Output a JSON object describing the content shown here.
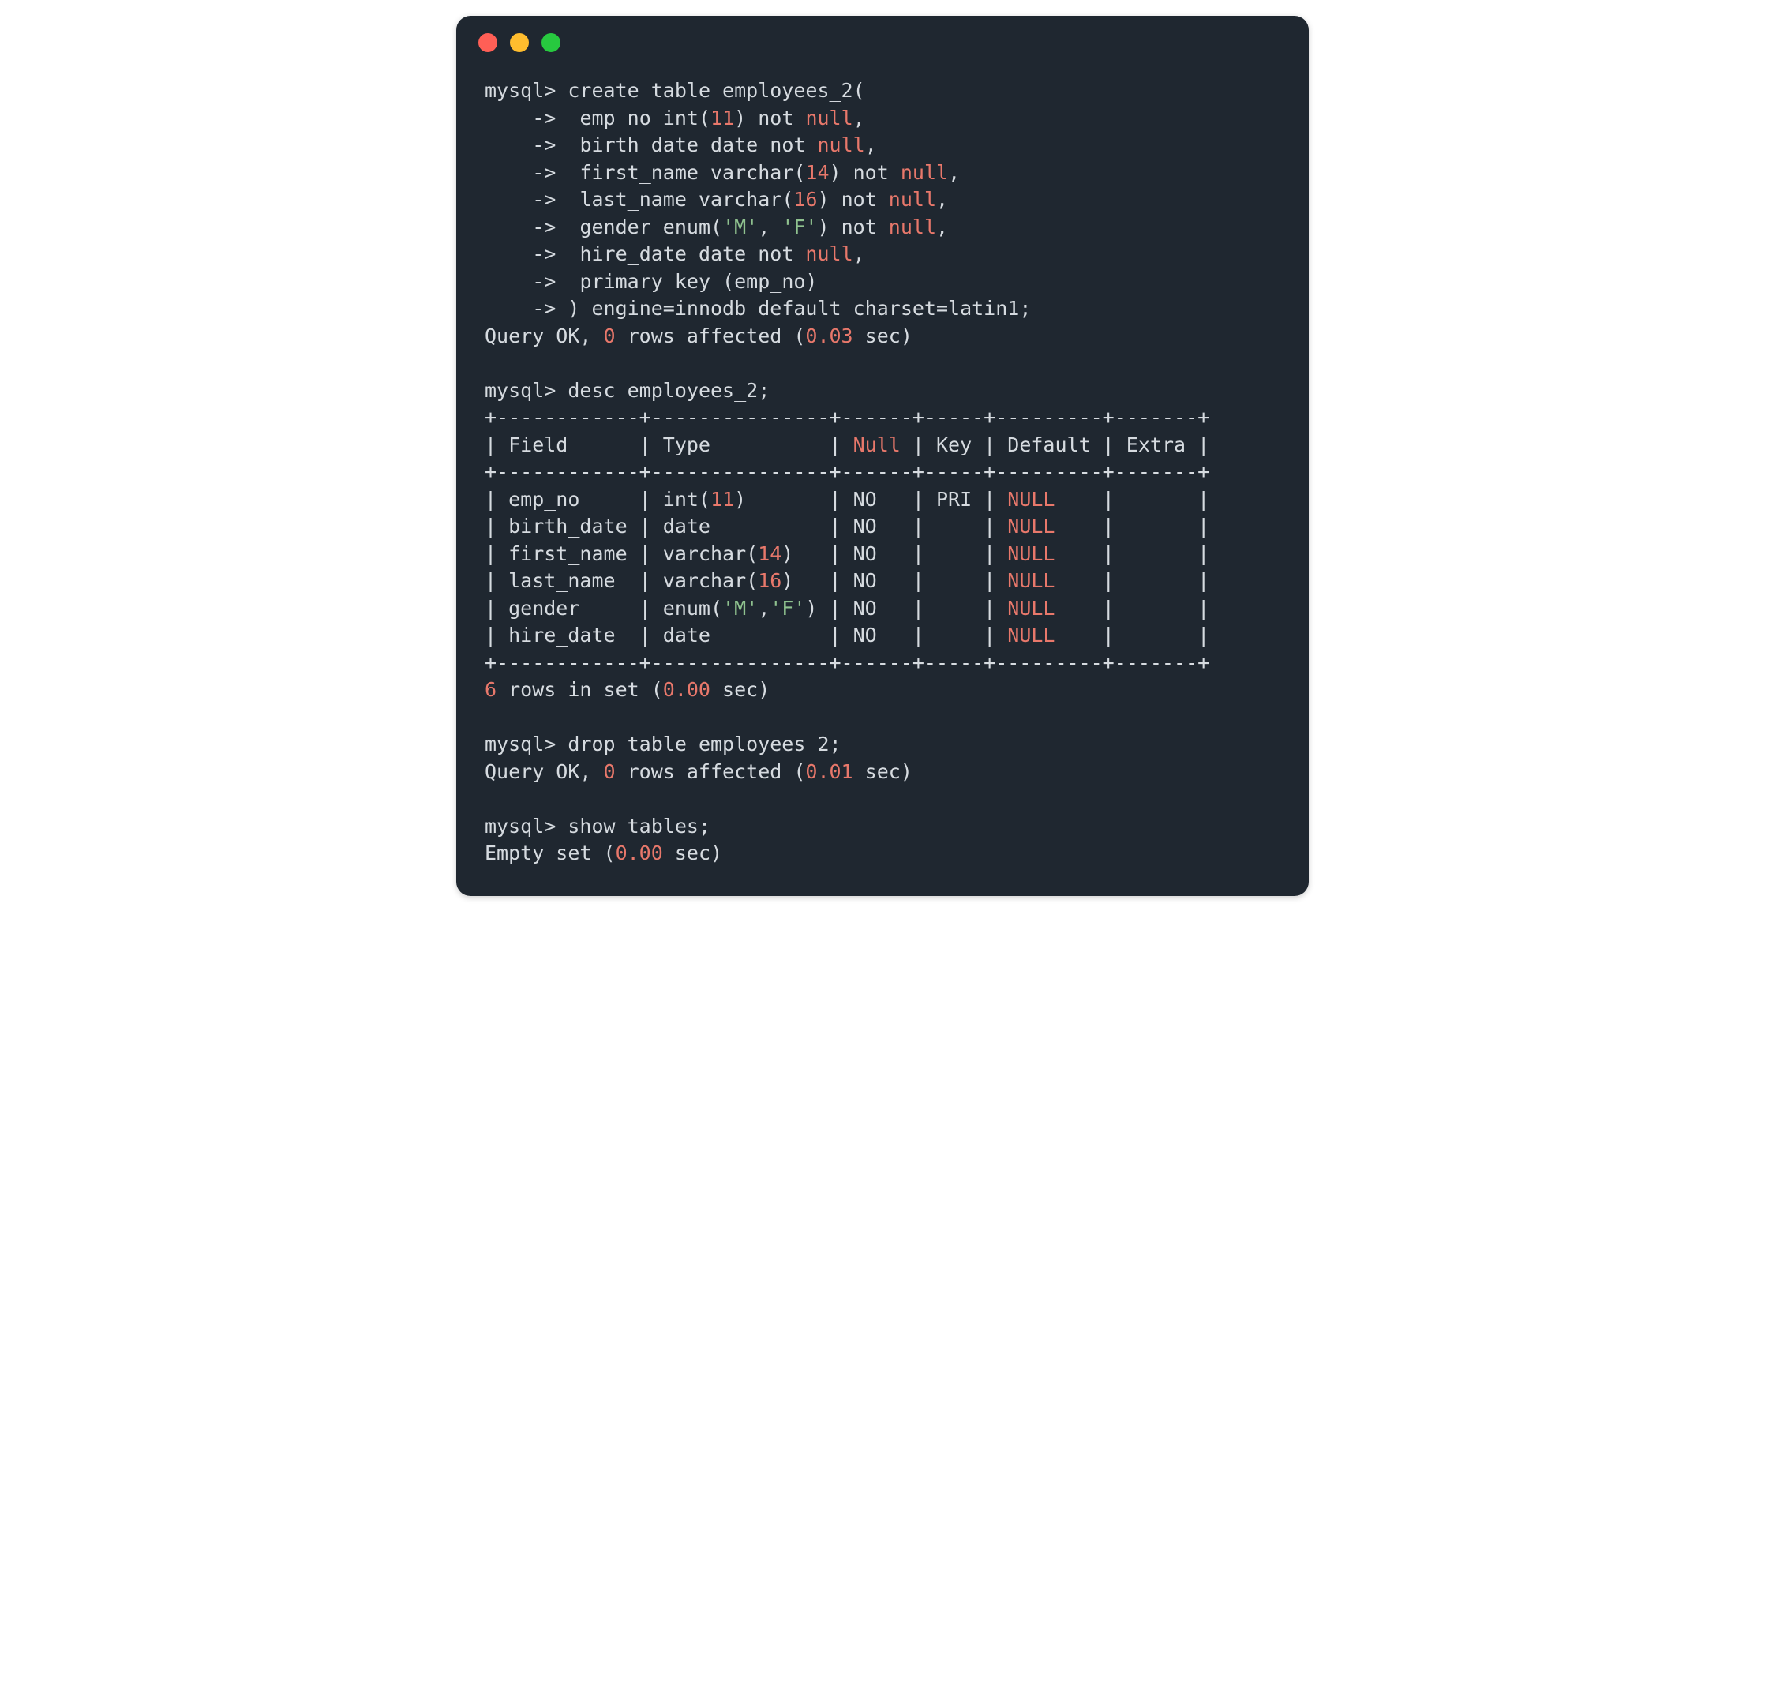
{
  "titlebar": {
    "buttons": [
      "close",
      "minimize",
      "zoom"
    ]
  },
  "prompt": "mysql>",
  "cont": "->",
  "create": {
    "l1": "create table employees_2(",
    "l2_a": " emp_no int(",
    "l2_num": "11",
    "l2_b": ") not ",
    "l2_kw": "null",
    "l2_c": ",",
    "l3_a": " birth_date date not ",
    "l3_kw": "null",
    "l3_c": ",",
    "l4_a": " first_name varchar(",
    "l4_num": "14",
    "l4_b": ") not ",
    "l4_kw": "null",
    "l4_c": ",",
    "l5_a": " last_name varchar(",
    "l5_num": "16",
    "l5_b": ") not ",
    "l5_kw": "null",
    "l5_c": ",",
    "l6_a": " gender enum(",
    "l6_s1": "'M'",
    "l6_m": ", ",
    "l6_s2": "'F'",
    "l6_b": ") not ",
    "l6_kw": "null",
    "l6_c": ",",
    "l7_a": " hire_date date not ",
    "l7_kw": "null",
    "l7_c": ",",
    "l8": " primary key (emp_no)",
    "l9": ") engine=innodb default charset=latin1;"
  },
  "result1": {
    "a": "Query OK, ",
    "n1": "0",
    "b": " rows affected (",
    "n2": "0.03",
    "c": " sec)"
  },
  "desc_cmd": "desc employees_2;",
  "table": {
    "border_top": "+------------+---------------+------+-----+---------+-------+",
    "header": {
      "a": "| Field      | Type          | ",
      "null_hdr": "Null",
      "b": " | Key | Default | Extra |"
    },
    "rows": [
      {
        "a": "| emp_no     | int(",
        "n": "11",
        "b": ")       | NO   | PRI | ",
        "nv": "NULL",
        "c": "    |       |"
      },
      {
        "a": "| birth_date | date          | NO   |     | ",
        "nv": "NULL",
        "c": "    |       |"
      },
      {
        "a": "| first_name | varchar(",
        "n": "14",
        "b": ")   | NO   |     | ",
        "nv": "NULL",
        "c": "    |       |"
      },
      {
        "a": "| last_name  | varchar(",
        "n": "16",
        "b": ")   | NO   |     | ",
        "nv": "NULL",
        "c": "    |       |"
      },
      {
        "a": "| gender     | enum(",
        "s1": "'M'",
        "m": ",",
        "s2": "'F'",
        "b": ") | NO   |     | ",
        "nv": "NULL",
        "c": "    |       |"
      },
      {
        "a": "| hire_date  | date          | NO   |     | ",
        "nv": "NULL",
        "c": "    |       |"
      }
    ]
  },
  "result2": {
    "n1": "6",
    "a": " rows in set (",
    "n2": "0.00",
    "b": " sec)"
  },
  "drop_cmd": "drop table employees_2;",
  "result3": {
    "a": "Query OK, ",
    "n1": "0",
    "b": " rows affected (",
    "n2": "0.01",
    "c": " sec)"
  },
  "show_cmd": "show tables;",
  "result4": {
    "a": "Empty set (",
    "n1": "0.00",
    "b": " sec)"
  }
}
